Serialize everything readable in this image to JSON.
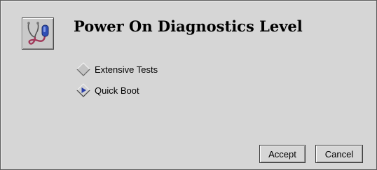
{
  "dialog": {
    "title": "Power On Diagnostics Level",
    "icon": "stethoscope-icon"
  },
  "options": [
    {
      "label": "Extensive Tests",
      "selected": false
    },
    {
      "label": "Quick Boot",
      "selected": true
    }
  ],
  "buttons": {
    "accept_label": "Accept",
    "cancel_label": "Cancel"
  },
  "colors": {
    "background": "#d6d6d6",
    "radio_selected": "#2a3fa8",
    "icon_tube": "#a03a5a"
  }
}
